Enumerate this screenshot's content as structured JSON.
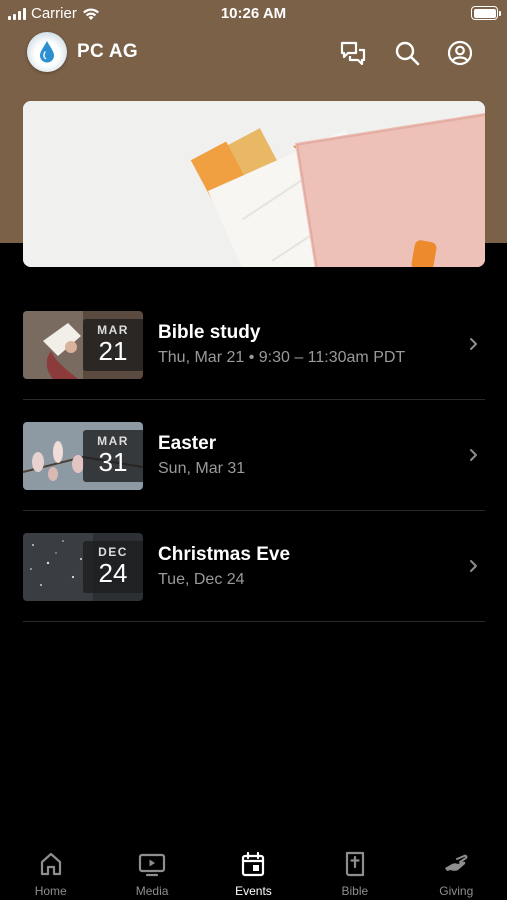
{
  "status_bar": {
    "carrier": "Carrier",
    "time": "10:26 AM"
  },
  "app": {
    "title": "PC AG"
  },
  "header_icons": [
    "chat-icon",
    "search-icon",
    "account-icon"
  ],
  "events": [
    {
      "month": "MAR",
      "day": "21",
      "title": "Bible study",
      "subtitle": "Thu, Mar 21 • 9:30 – 11:30am PDT"
    },
    {
      "month": "MAR",
      "day": "31",
      "title": "Easter",
      "subtitle": "Sun, Mar 31"
    },
    {
      "month": "DEC",
      "day": "24",
      "title": "Christmas Eve",
      "subtitle": "Tue, Dec 24"
    }
  ],
  "tabs": [
    {
      "label": "Home",
      "icon": "home-icon",
      "active": false
    },
    {
      "label": "Media",
      "icon": "tv-icon",
      "active": false
    },
    {
      "label": "Events",
      "icon": "calendar-icon",
      "active": true
    },
    {
      "label": "Bible",
      "icon": "bible-icon",
      "active": false
    },
    {
      "label": "Giving",
      "icon": "giving-hand-icon",
      "active": false
    }
  ],
  "colors": {
    "header_brown": "#7a6148",
    "background": "#000000",
    "active_tab": "#ffffff",
    "inactive_tab": "#8e8e8e"
  }
}
